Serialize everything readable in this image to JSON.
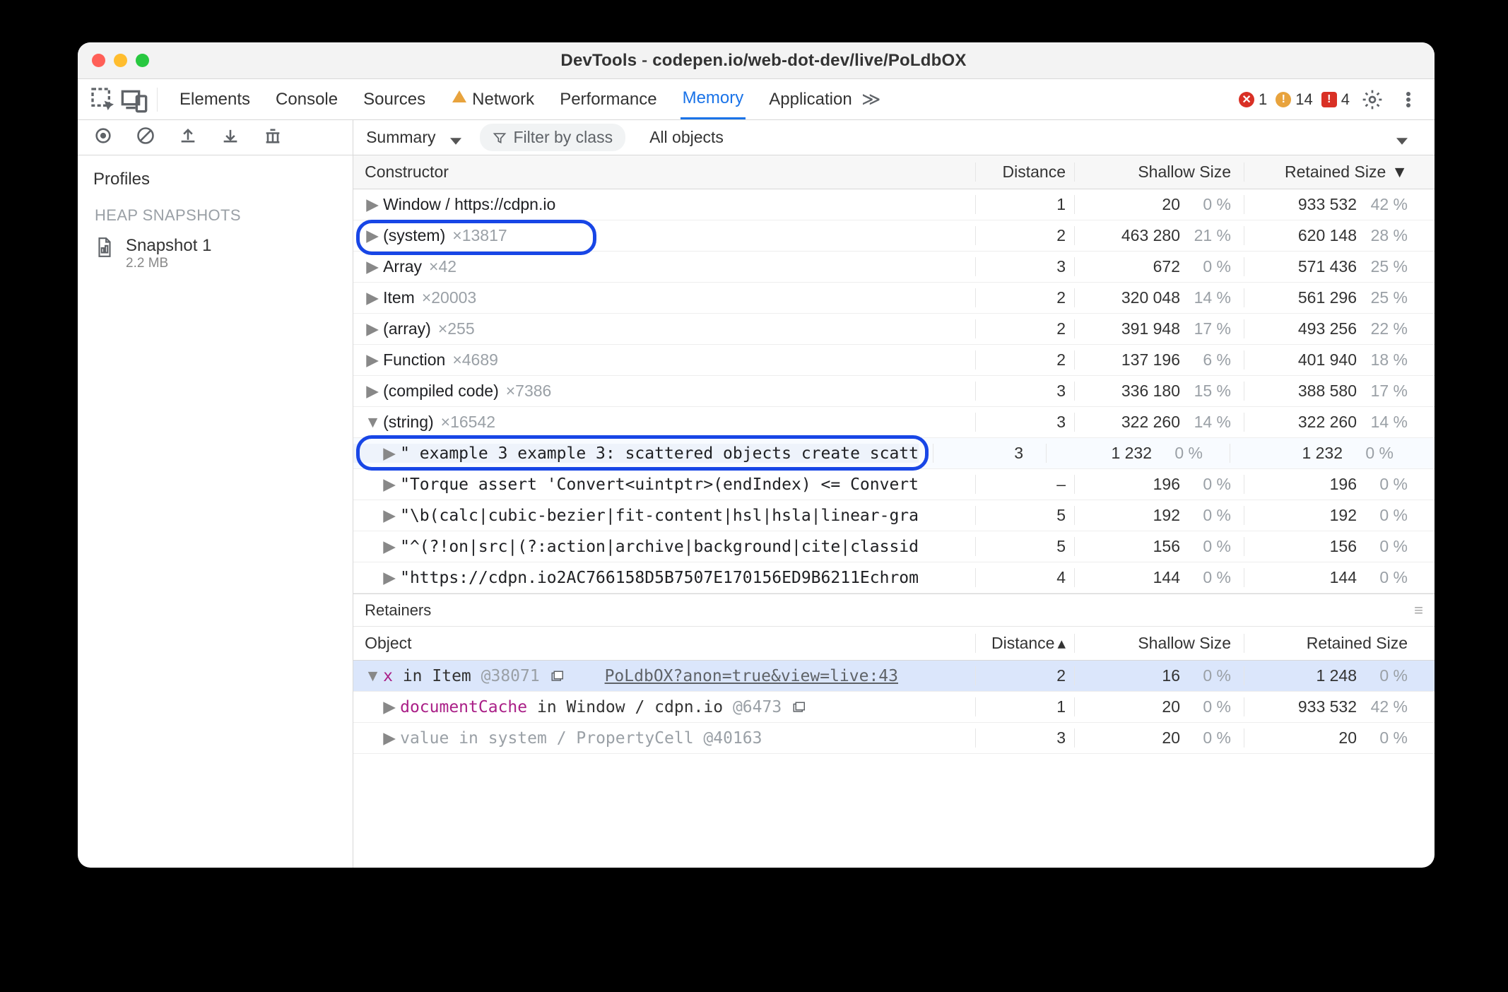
{
  "title": {
    "app": "DevTools",
    "path": "codepen.io/web-dot-dev/live/PoLdbOX"
  },
  "topTabs": [
    "Elements",
    "Console",
    "Sources",
    "Network",
    "Performance",
    "Memory",
    "Application"
  ],
  "topTabs_activeIndex": 5,
  "errors": {
    "err": "1",
    "warn": "14",
    "issue": "4"
  },
  "leftToolbar": [
    "record",
    "cancel",
    "load",
    "save",
    "gc"
  ],
  "profiles_header": "Profiles",
  "heap_label": "HEAP SNAPSHOTS",
  "snapshot": {
    "name": "Snapshot 1",
    "size": "2.2 MB"
  },
  "secondToolbar": {
    "view": "Summary",
    "filter_placeholder": "Filter by class",
    "scope": "All objects"
  },
  "columns": {
    "constructor": "Constructor",
    "distance": "Distance",
    "shallow": "Shallow Size",
    "retained": "Retained Size"
  },
  "rows": [
    {
      "lvl": 0,
      "arrow": "▶",
      "text": "Window / https://cdpn.io",
      "mult": "",
      "d": "1",
      "sh": "20",
      "shp": "0 %",
      "rt": "933 532",
      "rtp": "42 %"
    },
    {
      "lvl": 0,
      "arrow": "▶",
      "text": "(system)",
      "mult": "×13817",
      "d": "2",
      "sh": "463 280",
      "shp": "21 %",
      "rt": "620 148",
      "rtp": "28 %"
    },
    {
      "lvl": 0,
      "arrow": "▶",
      "text": "Array",
      "mult": "×42",
      "d": "3",
      "sh": "672",
      "shp": "0 %",
      "rt": "571 436",
      "rtp": "25 %"
    },
    {
      "lvl": 0,
      "arrow": "▶",
      "text": "Item",
      "mult": "×20003",
      "d": "2",
      "sh": "320 048",
      "shp": "14 %",
      "rt": "561 296",
      "rtp": "25 %"
    },
    {
      "lvl": 0,
      "arrow": "▶",
      "text": "(array)",
      "mult": "×255",
      "d": "2",
      "sh": "391 948",
      "shp": "17 %",
      "rt": "493 256",
      "rtp": "22 %"
    },
    {
      "lvl": 0,
      "arrow": "▶",
      "text": "Function",
      "mult": "×4689",
      "d": "2",
      "sh": "137 196",
      "shp": "6 %",
      "rt": "401 940",
      "rtp": "18 %"
    },
    {
      "lvl": 0,
      "arrow": "▶",
      "text": "(compiled code)",
      "mult": "×7386",
      "d": "3",
      "sh": "336 180",
      "shp": "15 %",
      "rt": "388 580",
      "rtp": "17 %"
    },
    {
      "lvl": 0,
      "arrow": "▼",
      "text": "(string)",
      "mult": "×16542",
      "d": "3",
      "sh": "322 260",
      "shp": "14 %",
      "rt": "322 260",
      "rtp": "14 %"
    },
    {
      "lvl": 1,
      "arrow": "▶",
      "sel": true,
      "mono": true,
      "text": "\" example 3 example 3: scattered objects create scatt",
      "d": "3",
      "sh": "1 232",
      "shp": "0 %",
      "rt": "1 232",
      "rtp": "0 %",
      "highlight": true
    },
    {
      "lvl": 1,
      "arrow": "▶",
      "mono": true,
      "red": true,
      "text": "\"Torque assert 'Convert<uintptr>(endIndex) <= Convert",
      "d": "–",
      "sh": "196",
      "shp": "0 %",
      "rt": "196",
      "rtp": "0 %"
    },
    {
      "lvl": 1,
      "arrow": "▶",
      "mono": true,
      "red": true,
      "text": "\"\\b(calc|cubic-bezier|fit-content|hsl|hsla|linear-gra",
      "d": "5",
      "sh": "192",
      "shp": "0 %",
      "rt": "192",
      "rtp": "0 %"
    },
    {
      "lvl": 1,
      "arrow": "▶",
      "mono": true,
      "red": true,
      "text": "\"^(?!on|src|(?:action|archive|background|cite|classid",
      "d": "5",
      "sh": "156",
      "shp": "0 %",
      "rt": "156",
      "rtp": "0 %"
    },
    {
      "lvl": 1,
      "arrow": "▶",
      "mono": true,
      "red": true,
      "text": "\"https://cdpn.io2AC766158D5B7507E170156ED9B6211Echrom",
      "d": "4",
      "sh": "144",
      "shp": "0 %",
      "rt": "144",
      "rtp": "0 %"
    }
  ],
  "retainers_title": "Retainers",
  "retainer_columns": {
    "object": "Object",
    "distance": "Distance",
    "shallow": "Shallow Size",
    "retained": "Retained Size",
    "sortAsc": "▴"
  },
  "rrows": [
    {
      "arrow": "▼",
      "sel": true,
      "prop": "x",
      "in": "in",
      "cls": "Item",
      "objid": "@38071",
      "popout": true,
      "link": "PoLdbOX?anon=true&view=live:43",
      "d": "2",
      "sh": "16",
      "shp": "0 %",
      "rt": "1 248",
      "rtp": "0 %",
      "highlight": true
    },
    {
      "arrow": "▶",
      "lvl": 1,
      "prop": "documentCache",
      "in": "in",
      "cls": "Window / cdpn.io",
      "objid": "@6473",
      "popout": true,
      "d": "1",
      "sh": "20",
      "shp": "0 %",
      "rt": "933 532",
      "rtp": "42 %"
    },
    {
      "arrow": "▶",
      "lvl": 1,
      "dim": true,
      "prop": "value",
      "in": "in",
      "cls": "system / PropertyCell",
      "objid": "@40163",
      "d": "3",
      "sh": "20",
      "shp": "0 %",
      "rt": "20",
      "rtp": "0 %"
    }
  ]
}
